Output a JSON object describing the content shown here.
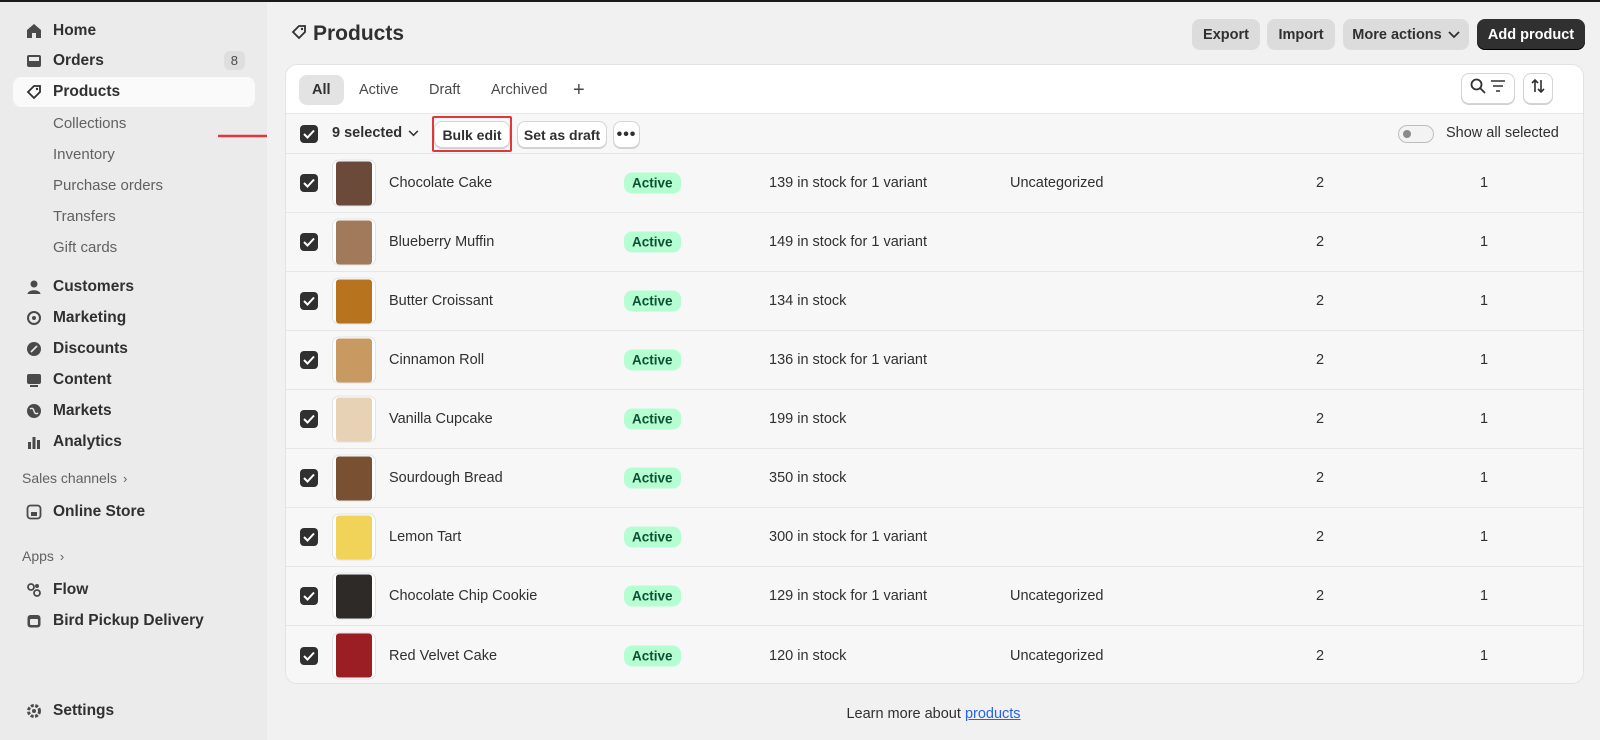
{
  "sidebar": {
    "items": [
      {
        "label": "Home",
        "icon": "home-icon"
      },
      {
        "label": "Orders",
        "icon": "inbox-icon",
        "badge": "8"
      },
      {
        "label": "Products",
        "icon": "tag-icon",
        "active": true
      },
      {
        "label": "Customers",
        "icon": "person-icon"
      },
      {
        "label": "Marketing",
        "icon": "target-icon"
      },
      {
        "label": "Discounts",
        "icon": "discount-icon"
      },
      {
        "label": "Content",
        "icon": "content-icon"
      },
      {
        "label": "Markets",
        "icon": "globe-icon"
      },
      {
        "label": "Analytics",
        "icon": "bar-chart-icon"
      }
    ],
    "subitems": [
      "Collections",
      "Inventory",
      "Purchase orders",
      "Transfers",
      "Gift cards"
    ],
    "sales_channels_label": "Sales channels",
    "online_store_label": "Online Store",
    "apps_label": "Apps",
    "apps": [
      "Flow",
      "Bird Pickup Delivery"
    ],
    "settings_label": "Settings"
  },
  "header": {
    "title": "Products",
    "export_label": "Export",
    "import_label": "Import",
    "more_actions_label": "More actions",
    "add_product_label": "Add product"
  },
  "tabs": [
    "All",
    "Active",
    "Draft",
    "Archived"
  ],
  "bulk": {
    "selected_label": "9 selected",
    "bulk_edit_label": "Bulk edit",
    "set_draft_label": "Set as draft",
    "show_all_label": "Show all selected"
  },
  "products": [
    {
      "name": "Chocolate Cake",
      "status": "Active",
      "inventory": "139 in stock for 1 variant",
      "category": "Uncategorized",
      "col1": "2",
      "col2": "1",
      "thumb_color": "#6b4a3a"
    },
    {
      "name": "Blueberry Muffin",
      "status": "Active",
      "inventory": "149 in stock for 1 variant",
      "category": "",
      "col1": "2",
      "col2": "1",
      "thumb_color": "#a07a5a"
    },
    {
      "name": "Butter Croissant",
      "status": "Active",
      "inventory": "134 in stock",
      "category": "",
      "col1": "2",
      "col2": "1",
      "thumb_color": "#b8731e"
    },
    {
      "name": "Cinnamon Roll",
      "status": "Active",
      "inventory": "136 in stock for 1 variant",
      "category": "",
      "col1": "2",
      "col2": "1",
      "thumb_color": "#c89a62"
    },
    {
      "name": "Vanilla Cupcake",
      "status": "Active",
      "inventory": "199 in stock",
      "category": "",
      "col1": "2",
      "col2": "1",
      "thumb_color": "#e8d2b6"
    },
    {
      "name": "Sourdough Bread",
      "status": "Active",
      "inventory": "350 in stock",
      "category": "",
      "col1": "2",
      "col2": "1",
      "thumb_color": "#7a5032"
    },
    {
      "name": "Lemon Tart",
      "status": "Active",
      "inventory": "300 in stock for 1 variant",
      "category": "",
      "col1": "2",
      "col2": "1",
      "thumb_color": "#f1d35a"
    },
    {
      "name": "Chocolate Chip Cookie",
      "status": "Active",
      "inventory": "129 in stock for 1 variant",
      "category": "Uncategorized",
      "col1": "2",
      "col2": "1",
      "thumb_color": "#2d2a28"
    },
    {
      "name": "Red Velvet Cake",
      "status": "Active",
      "inventory": "120 in stock",
      "category": "Uncategorized",
      "col1": "2",
      "col2": "1",
      "thumb_color": "#9a1e24"
    }
  ],
  "footer": {
    "text": "Learn more about",
    "link": "products"
  },
  "colors": {
    "accent_dark": "#303030",
    "badge_bg": "#b4fed2",
    "badge_text": "#0c5132",
    "highlight": "#e0363c"
  }
}
